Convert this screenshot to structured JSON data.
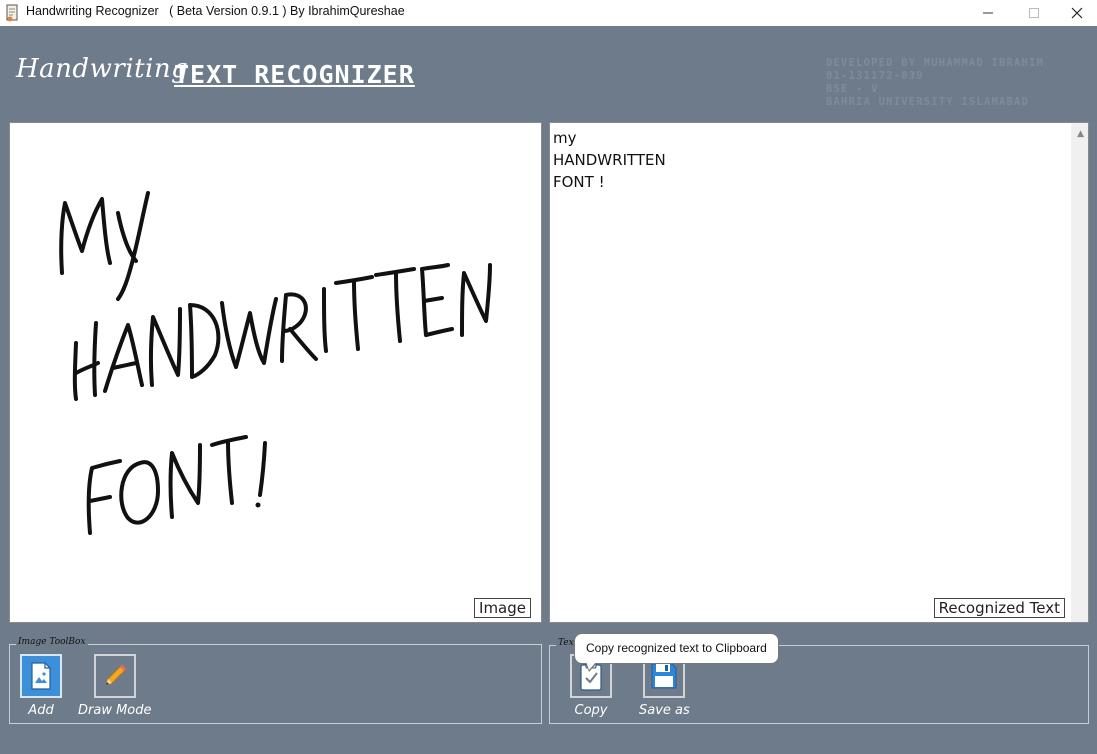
{
  "window": {
    "title": "Handwriting Recognizer   ( Beta Version 0.9.1 ) By IbrahimQureshae",
    "minimize_icon": "minimize-icon",
    "maximize_icon": "maximize-icon",
    "close_icon": "close-icon"
  },
  "header": {
    "script_title": "Handwriting",
    "main_title": "TEXT RECOGNIZER",
    "developer_lines": [
      "DEVELOPED BY MUHAMMAD IBRAHIM",
      "01-131172-039",
      "BSE - V",
      "BAHRIA UNIVERSITY ISLAMABAD"
    ]
  },
  "image_panel": {
    "label": "Image",
    "handwriting_lines": [
      "MY",
      "HANDWRITTEN",
      "FONT!"
    ]
  },
  "text_panel": {
    "label": "Recognized Text",
    "lines": [
      "my",
      "HANDWRITTEN",
      "FONT !"
    ]
  },
  "image_toolbox": {
    "legend": "Image ToolBox",
    "tools": [
      {
        "label": "Add",
        "icon": "add-image-icon",
        "active": true
      },
      {
        "label": "Draw Mode",
        "icon": "pencil-icon",
        "active": false
      }
    ]
  },
  "text_toolbox": {
    "legend": "Text ToolBox",
    "tools": [
      {
        "label": "Copy",
        "icon": "clipboard-icon"
      },
      {
        "label": "Save as",
        "icon": "floppy-disk-icon"
      }
    ]
  },
  "tooltip": {
    "text": "Copy recognized text to Clipboard"
  },
  "colors": {
    "background": "#6e7b8b",
    "active_tool": "#3d8fd9",
    "pencil": "#f5a623"
  }
}
